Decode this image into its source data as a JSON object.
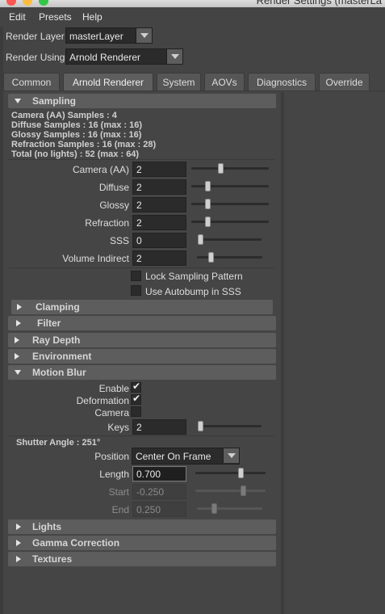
{
  "window": {
    "title": "Render Settings (masterLa"
  },
  "menu": {
    "items": [
      "Edit",
      "Presets",
      "Help"
    ]
  },
  "render_layer": {
    "label": "Render Layer",
    "value": "masterLayer"
  },
  "render_using": {
    "label": "Render Using",
    "value": "Arnold Renderer"
  },
  "tabs": [
    "Common",
    "Arnold Renderer",
    "System",
    "AOVs",
    "Diagnostics",
    "Override"
  ],
  "sampling": {
    "title": "Sampling",
    "info": [
      "Camera (AA) Samples : 4",
      "Diffuse Samples : 16 (max : 16)",
      "Glossy Samples : 16 (max : 16)",
      "Refraction Samples : 16 (max : 28)",
      "Total (no lights) : 52 (max : 64)"
    ],
    "rows": [
      {
        "label": "Camera (AA)",
        "value": "2",
        "level": 0.3
      },
      {
        "label": "Diffuse",
        "value": "2",
        "level": 0.2
      },
      {
        "label": "Glossy",
        "value": "2",
        "level": 0.2
      },
      {
        "label": "Refraction",
        "value": "2",
        "level": 0.2
      },
      {
        "label": "SSS",
        "value": "0",
        "level": 0.0
      },
      {
        "label": "Volume Indirect",
        "value": "2",
        "level": 0.2
      }
    ],
    "lock_sampling_pattern": {
      "label": "Lock Sampling Pattern",
      "checked": false
    },
    "use_autobump": {
      "label": "Use Autobump in SSS",
      "checked": false
    }
  },
  "sections": {
    "clamping": "Clamping",
    "filter": "Filter",
    "ray_depth": "Ray Depth",
    "environment": "Environment",
    "motion_blur": "Motion Blur",
    "lights": "Lights",
    "gamma_correction": "Gamma Correction",
    "textures": "Textures"
  },
  "motion_blur": {
    "enable": {
      "label": "Enable",
      "checked": true
    },
    "deformation": {
      "label": "Deformation",
      "checked": true
    },
    "camera": {
      "label": "Camera",
      "checked": false
    },
    "keys": {
      "label": "Keys",
      "value": "2",
      "level": 0.0
    },
    "shutter_angle": "Shutter Angle : 251°",
    "position": {
      "label": "Position",
      "value": "Center On Frame"
    },
    "length": {
      "label": "Length",
      "value": "0.700",
      "level": 0.7
    },
    "start": {
      "label": "Start",
      "value": "-0.250",
      "level": 0.7
    },
    "end": {
      "label": "End",
      "value": "0.250",
      "level": 0.3
    }
  },
  "colors": {
    "background": "#444444",
    "field": "#2b2b2b",
    "section_header": "#5d5d5d",
    "traffic_red": "#fc5753",
    "traffic_yellow": "#fdbc40",
    "traffic_green": "#33c748"
  }
}
